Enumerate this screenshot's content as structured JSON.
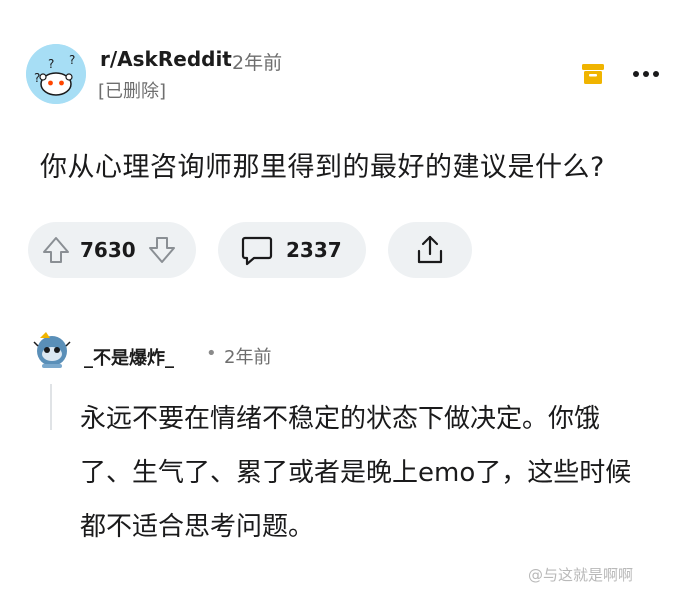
{
  "post": {
    "subreddit": "r/AskReddit",
    "time": "2年前",
    "author": "[已删除]",
    "title": "你从心理咨询师那里得到的最好的建议是什么?",
    "upvotes": "7630",
    "comments": "2337"
  },
  "comment": {
    "author": "_不是爆炸_",
    "separator": "•",
    "time": "2年前",
    "body": "永远不要在情绪不稳定的状态下做决定。你饿了、生气了、累了或者是晚上emo了，这些时候都不适合思考问题。"
  },
  "watermark": "@与这就是啊啊",
  "icons": {
    "archive": "archive-icon",
    "more": "more-options-icon",
    "upvote": "upvote-arrow-icon",
    "downvote": "downvote-arrow-icon",
    "comment": "comment-bubble-icon",
    "share": "share-icon"
  },
  "colors": {
    "archive_accent": "#f0b400",
    "pill_background": "#eef1f3",
    "avatar_background": "#a7def5"
  }
}
